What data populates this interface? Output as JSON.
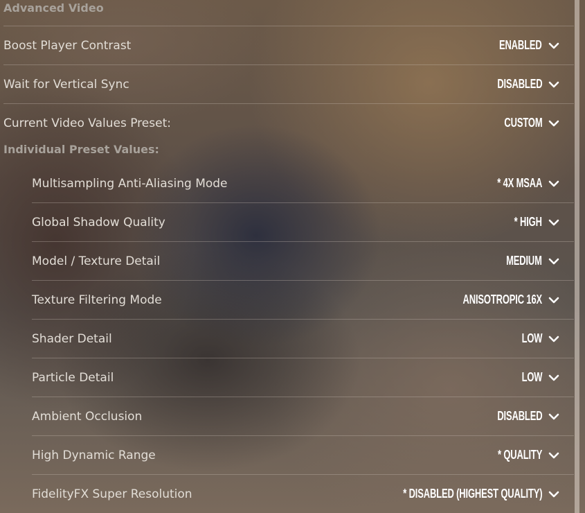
{
  "section": {
    "title": "Advanced Video",
    "subheading": "Individual Preset Values:"
  },
  "top_settings": [
    {
      "label": "Boost Player Contrast",
      "value": "ENABLED"
    },
    {
      "label": "Wait for Vertical Sync",
      "value": "DISABLED"
    },
    {
      "label": "Current Video Values Preset:",
      "value": "CUSTOM"
    }
  ],
  "preset_settings": [
    {
      "label": "Multisampling Anti-Aliasing Mode",
      "value": "* 4X MSAA"
    },
    {
      "label": "Global Shadow Quality",
      "value": "* HIGH"
    },
    {
      "label": "Model / Texture Detail",
      "value": "MEDIUM"
    },
    {
      "label": "Texture Filtering Mode",
      "value": "ANISOTROPIC 16X"
    },
    {
      "label": "Shader Detail",
      "value": "LOW"
    },
    {
      "label": "Particle Detail",
      "value": "LOW"
    },
    {
      "label": "Ambient Occlusion",
      "value": "DISABLED"
    },
    {
      "label": "High Dynamic Range",
      "value": "* QUALITY"
    },
    {
      "label": "FidelityFX Super Resolution",
      "value": "* DISABLED (HIGHEST QUALITY)"
    }
  ],
  "icons": {
    "dropdown": "chevron-down-icon"
  },
  "colors": {
    "label_text": "#e2ddd6",
    "value_text": "#ffffff",
    "heading_text": "#a8a29b"
  }
}
